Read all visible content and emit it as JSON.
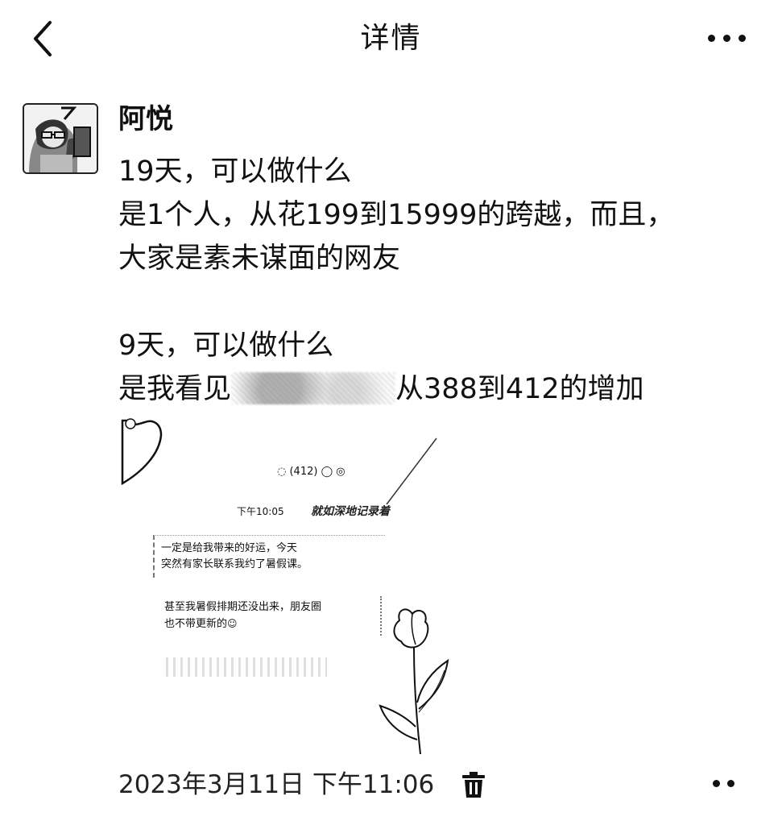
{
  "header": {
    "title": "详情",
    "back_icon": "chevron-left-icon",
    "more_icon": "more-horizontal-icon"
  },
  "post": {
    "author": "阿悦",
    "lines": [
      "19天，可以做什么",
      "是1个人，从花199到15999的跨越，而且，",
      "大家是素未谋面的网友",
      "9天，可以做什么"
    ],
    "line5_prefix": "是我看见",
    "line5_suffix": "从388到412的增加",
    "image": {
      "contact_label": "(412)",
      "time": "下午10:05",
      "handwriting": "就如深地记录着",
      "bubble1": [
        "一定是给我带来的好运，今天",
        "突然有家长联系我约了暑假课。"
      ],
      "bubble2": [
        "甚至我暑假排期还没出来，朋友圈",
        "也不带更新的"
      ]
    },
    "timestamp": "2023年3月11日 下午11:06"
  },
  "icons": {
    "trash": "trash-icon",
    "footer_more": "more-dots-icon"
  },
  "colors": {
    "text": "#111111",
    "background": "#ffffff"
  }
}
